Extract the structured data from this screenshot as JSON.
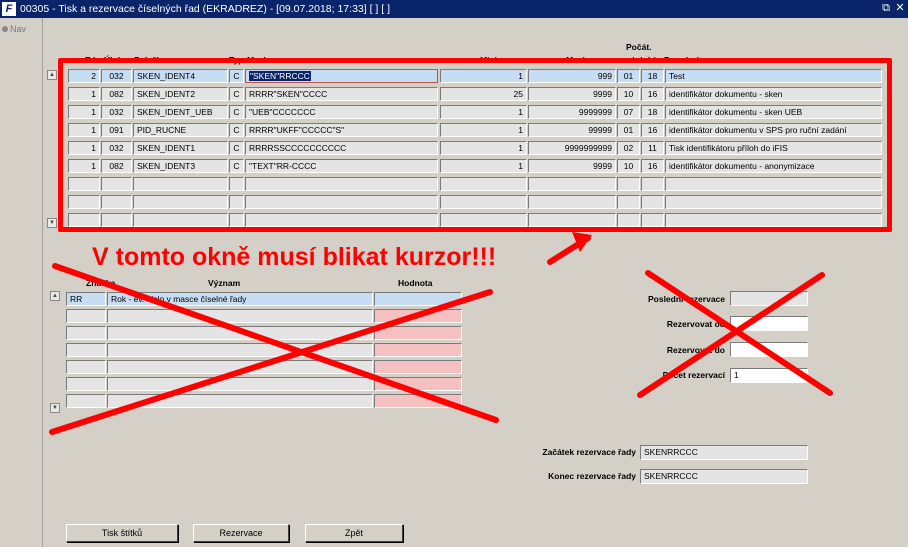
{
  "window": {
    "title": "00305 - Tisk a rezervace číselných řad (EKRADREZ) - [09.07.2018; 17:33]  [ ]  [ ]",
    "icon": "F",
    "restore_glyph": "⧉",
    "close_glyph": "✕"
  },
  "nav": {
    "label": "Nav"
  },
  "top_table": {
    "headers": {
      "el": "E.I.",
      "uloha": "Úloha",
      "polozka": "Položka",
      "typ": "Typ",
      "maska": "Maska",
      "minimum": "Minimum",
      "maximum": "Maximum",
      "pocat_1": "Počát.",
      "pocat_2": "období",
      "poznamka": "Poznámka"
    },
    "rows": [
      {
        "el": "2",
        "uloha": "032",
        "polozka": "SKEN_IDENT4",
        "typ": "C",
        "maska": "\"SKEN\"RRCCC",
        "minimum": "1",
        "maximum": "999",
        "obdobi": "01",
        "pocat": "18",
        "poznamka": "Test"
      },
      {
        "el": "1",
        "uloha": "082",
        "polozka": "SKEN_IDENT2",
        "typ": "C",
        "maska": "RRRR\"SKEN\"CCCC",
        "minimum": "25",
        "maximum": "9999",
        "obdobi": "10",
        "pocat": "16",
        "poznamka": "identifikátor dokumentu - sken"
      },
      {
        "el": "1",
        "uloha": "032",
        "polozka": "SKEN_IDENT_UEB",
        "typ": "C",
        "maska": "\"UEB\"CCCCCCC",
        "minimum": "1",
        "maximum": "9999999",
        "obdobi": "07",
        "pocat": "18",
        "poznamka": "identifikátor dokumentu - sken UEB"
      },
      {
        "el": "1",
        "uloha": "091",
        "polozka": "PID_RUCNE",
        "typ": "C",
        "maska": "RRRR\"UKFF\"CCCCC\"S\"",
        "minimum": "1",
        "maximum": "99999",
        "obdobi": "01",
        "pocat": "16",
        "poznamka": "identifikátor dokumentu v SPS pro ruční zadání"
      },
      {
        "el": "1",
        "uloha": "032",
        "polozka": "SKEN_IDENT1",
        "typ": "C",
        "maska": "RRRRSSCCCCCCCCCC",
        "minimum": "1",
        "maximum": "9999999999",
        "obdobi": "02",
        "pocat": "11",
        "poznamka": "Tisk identifikátoru příloh do iFIS"
      },
      {
        "el": "1",
        "uloha": "082",
        "polozka": "SKEN_IDENT3",
        "typ": "C",
        "maska": "\"TEXT\"RR-CCCC",
        "minimum": "1",
        "maximum": "9999",
        "obdobi": "10",
        "pocat": "16",
        "poznamka": "identifikátor dokumentu - anonymizace"
      },
      {
        "el": "",
        "uloha": "",
        "polozka": "",
        "typ": "",
        "maska": "",
        "minimum": "",
        "maximum": "",
        "obdobi": "",
        "pocat": "",
        "poznamka": ""
      },
      {
        "el": "",
        "uloha": "",
        "polozka": "",
        "typ": "",
        "maska": "",
        "minimum": "",
        "maximum": "",
        "obdobi": "",
        "pocat": "",
        "poznamka": ""
      },
      {
        "el": "",
        "uloha": "",
        "polozka": "",
        "typ": "",
        "maska": "",
        "minimum": "",
        "maximum": "",
        "obdobi": "",
        "pocat": "",
        "poznamka": ""
      }
    ]
  },
  "mid_table": {
    "headers": {
      "znacka": "Značka",
      "vyznam": "Význam",
      "hodnota": "Hodnota"
    },
    "rows": [
      {
        "znacka": "RR",
        "vyznam": "Rok - ev. číslo v masce číselné řady",
        "hodnota": ""
      },
      {
        "znacka": "",
        "vyznam": "",
        "hodnota": ""
      },
      {
        "znacka": "",
        "vyznam": "",
        "hodnota": ""
      },
      {
        "znacka": "",
        "vyznam": "",
        "hodnota": ""
      },
      {
        "znacka": "",
        "vyznam": "",
        "hodnota": ""
      },
      {
        "znacka": "",
        "vyznam": "",
        "hodnota": ""
      },
      {
        "znacka": "",
        "vyznam": "",
        "hodnota": ""
      }
    ]
  },
  "reservation_form": {
    "posledni_label": "Poslední rezervace",
    "posledni_value": "",
    "od_label": "Rezervovat od",
    "od_value": "",
    "do_label": "Rezervovat do",
    "do_value": "",
    "pocet_label": "Počet rezervací",
    "pocet_value": "1"
  },
  "range": {
    "zacatek_label": "Začátek rezervace řady",
    "zacatek_value": "SKENRRCCC",
    "konec_label": "Konec rezervace řady",
    "konec_value": "SKENRRCCC"
  },
  "buttons": {
    "tisk": "Tisk štítků",
    "rezervace": "Rezervace",
    "zpet": "Zpět"
  },
  "annotation": {
    "text": "V tomto okně musí blikat kurzor!!!",
    "color": "#ff0000"
  },
  "colors": {
    "titlebar": "#0a246a",
    "selected_row": "#c6ddf4",
    "value_cell": "#f4c0c0",
    "background": "#d4d0c8"
  }
}
